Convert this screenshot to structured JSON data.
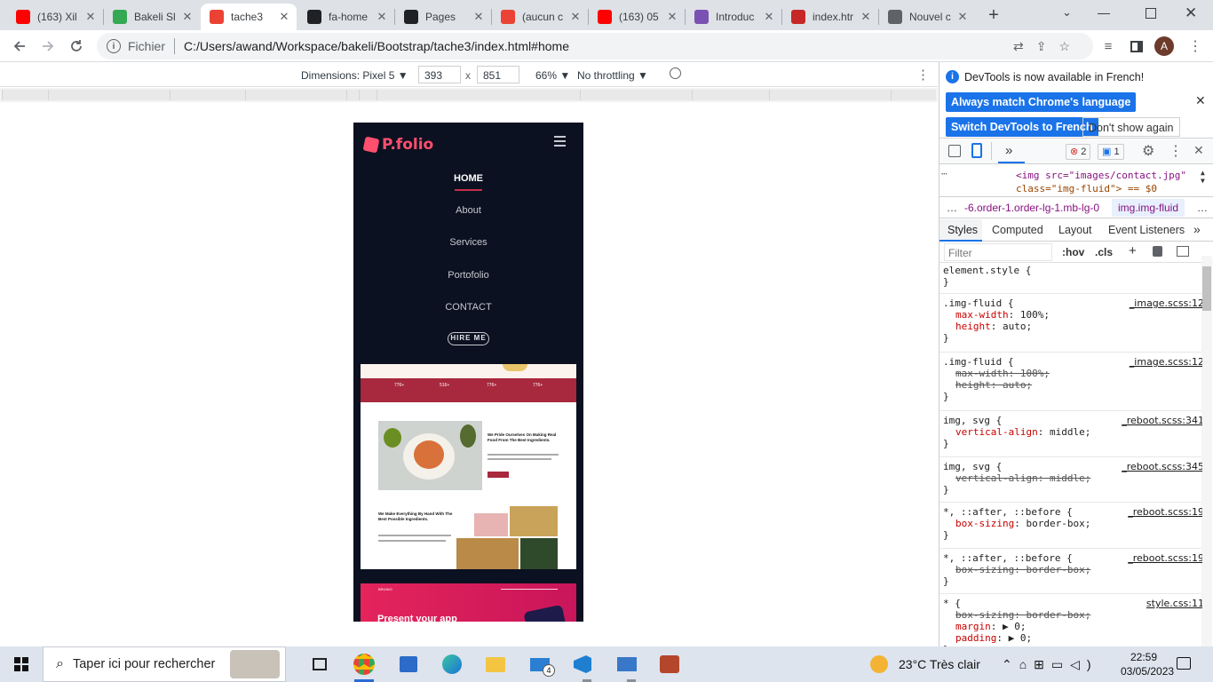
{
  "tabs": [
    {
      "title": "(163) Xil",
      "fav": "youtube-icon",
      "color": "#ff0000"
    },
    {
      "title": "Bakeli Sl",
      "fav": "drive-icon",
      "color": "#34a853"
    },
    {
      "title": "tache3",
      "fav": "page-icon",
      "color": "#ea4335"
    },
    {
      "title": "fa-home",
      "fav": "flag-icon",
      "color": "#202124"
    },
    {
      "title": "Pages",
      "fav": "github-icon",
      "color": "#202124"
    },
    {
      "title": "(aucun c",
      "fav": "gmail-icon",
      "color": "#ea4335"
    },
    {
      "title": "(163) 05",
      "fav": "youtube-icon",
      "color": "#ff0000"
    },
    {
      "title": "Introduc",
      "fav": "bootstrap-icon",
      "color": "#7952b3"
    },
    {
      "title": "index.htr",
      "fav": "w3-icon",
      "color": "#c62828"
    },
    {
      "title": "Nouvel c",
      "fav": "chrome-icon",
      "color": "#5f6368"
    }
  ],
  "toolbar": {
    "fichier": "Fichier",
    "url": "C:/Users/awand/Workspace/bakeli/Bootstrap/tache3/index.html#home",
    "avatar": "A"
  },
  "devbar": {
    "device": "Dimensions: Pixel 5 ▼",
    "width": "393",
    "x": "x",
    "height": "851",
    "zoom": "66% ▼",
    "throttle": "No throttling ▼"
  },
  "phone": {
    "logo": "P.folio",
    "nav": [
      "HOME",
      "About",
      "Services",
      "Portofolio",
      "CONTACT"
    ],
    "hire": "HIRE ME",
    "thumb1": {
      "stats": [
        "776+",
        "516+",
        "776+",
        "776+"
      ],
      "heading": "We Pride Ourselves On Making Real Food From The Best Ingredients.",
      "heading2": "We Make Everything By Hand With The Best Possible Ingredients."
    },
    "thumb2": {
      "logo": "BRUNIO",
      "heading": "Present your app"
    }
  },
  "devtools": {
    "banner_text": "DevTools is now available in French!",
    "btn_match": "Always match Chrome's language",
    "btn_switch": "Switch DevTools to French",
    "btn_dont": "Don't show again",
    "errors": "2",
    "messages": "1",
    "dom_line1": "<img src=\"images/contact.jpg\"",
    "dom_line2": "class=\"img-fluid\"> == $0",
    "crumb1": "-6.order-1.order-lg-1.mb-lg-0",
    "crumb2": "img.img-fluid",
    "tabs": [
      "Styles",
      "Computed",
      "Layout",
      "Event Listeners"
    ],
    "filter_placeholder": "Filter",
    "hov": ":hov",
    "cls": ".cls",
    "rules": [
      {
        "selector": "element.style {",
        "source": "",
        "props": []
      },
      {
        "selector": ".img-fluid {",
        "source": "_image.scss:12",
        "props": [
          {
            "n": "max-width",
            "v": "100%;",
            "s": false
          },
          {
            "n": "height",
            "v": "auto;",
            "s": false
          }
        ]
      },
      {
        "selector": ".img-fluid {",
        "source": "_image.scss:12",
        "props": [
          {
            "n": "max-width",
            "v": "100%;",
            "s": true
          },
          {
            "n": "height",
            "v": "auto;",
            "s": true
          }
        ]
      },
      {
        "selector": "img, svg {",
        "source": "_reboot.scss:341",
        "props": [
          {
            "n": "vertical-align",
            "v": "middle;",
            "s": false
          }
        ]
      },
      {
        "selector": "img, svg {",
        "source": "_reboot.scss:345",
        "props": [
          {
            "n": "vertical-align",
            "v": "middle;",
            "s": true
          }
        ]
      },
      {
        "selector": "*, ::after, ::before {",
        "source": "_reboot.scss:19",
        "props": [
          {
            "n": "box-sizing",
            "v": "border-box;",
            "s": false
          }
        ]
      },
      {
        "selector": "*, ::after, ::before {",
        "source": "_reboot.scss:19",
        "props": [
          {
            "n": "box-sizing",
            "v": "border-box;",
            "s": true
          }
        ]
      },
      {
        "selector": "* {",
        "source": "style.css:11",
        "props": [
          {
            "n": "box-sizing",
            "v": "border-box;",
            "s": true
          },
          {
            "n": "margin",
            "v": "▶ 0;",
            "s": false
          },
          {
            "n": "padding",
            "v": "▶ 0;",
            "s": false
          }
        ]
      }
    ]
  },
  "taskbar": {
    "search_placeholder": "Taper ici pour rechercher",
    "weather": "23°C  Très clair",
    "time": "22:59",
    "date": "03/05/2023",
    "mail_badge": "4"
  }
}
